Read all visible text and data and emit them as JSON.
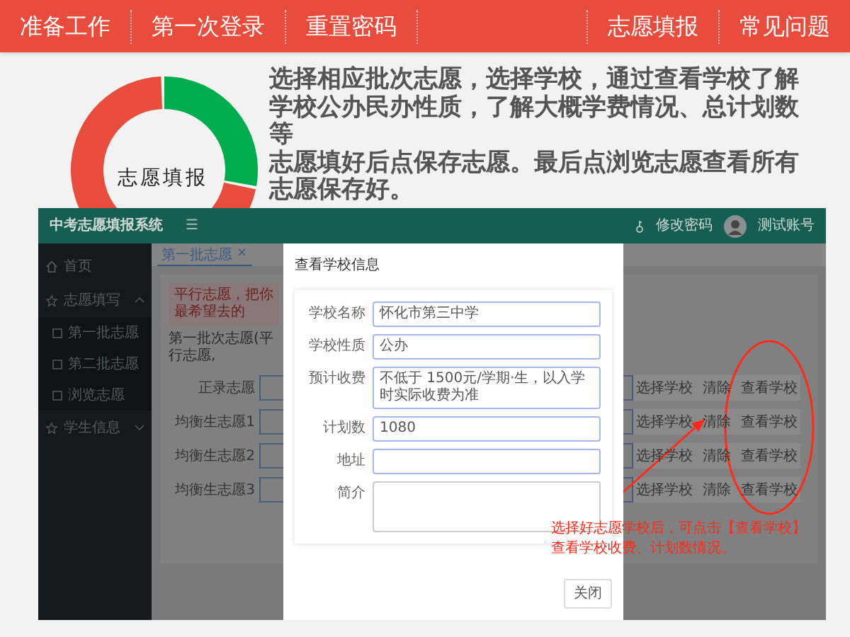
{
  "top_nav": {
    "left": [
      "准备工作",
      "第一次登录",
      "重置密码"
    ],
    "right": [
      "志愿填报",
      "常见问题"
    ]
  },
  "donut_label": "志愿填报",
  "intro": [
    "选择相应批次志愿，选择学校，通过查看学校了解学校公办民办性质，了解大概学费情况、总计划数等",
    "志愿填好后点保存志愿。最后点浏览志愿查看所有志愿保存好。"
  ],
  "app": {
    "title": "中考志愿填报系统",
    "menu_icon": "☰",
    "change_password": "修改密码",
    "account": "测试账号",
    "sidebar": [
      {
        "label": "首页"
      },
      {
        "label": "志愿填写",
        "expanded": true,
        "children": [
          {
            "label": "第一批志愿"
          },
          {
            "label": "第二批志愿"
          },
          {
            "label": "浏览志愿"
          }
        ]
      },
      {
        "label": "学生信息",
        "expanded": false
      }
    ],
    "tab": {
      "label": "第一批志愿",
      "close": "×"
    },
    "alert": "平行志愿，把你最希望去的",
    "card_title": "第一批次志愿(平行志愿,",
    "rows": [
      {
        "label": "正录志愿",
        "actions": [
          "选择学校",
          "清除",
          "查看学校"
        ]
      },
      {
        "label": "均衡生志愿1",
        "actions": [
          "选择学校",
          "清除",
          "查看学校"
        ]
      },
      {
        "label": "均衡生志愿2",
        "actions": [
          "选择学校",
          "清除",
          "查看学校"
        ]
      },
      {
        "label": "均衡生志愿3",
        "actions": [
          "选择学校",
          "清除",
          "查看学校"
        ]
      }
    ],
    "modal": {
      "title": "查看学校信息",
      "fields": [
        {
          "label": "学校名称",
          "value": "怀化市第三中学",
          "kind": "input"
        },
        {
          "label": "学校性质",
          "value": "公办",
          "kind": "input"
        },
        {
          "label": "预计收费",
          "value": "不低于 1500元/学期·生，以入学时实际收费为准",
          "kind": "input"
        },
        {
          "label": "计划数",
          "value": "1080",
          "kind": "input"
        },
        {
          "label": "地址",
          "kind": "input"
        },
        {
          "label": "简介",
          "kind": "textarea"
        }
      ],
      "close_button": "关闭"
    },
    "annotation": [
      "选择好志愿学校后，可点击【查看学校】",
      "查看学校收费、计划数情况。"
    ]
  }
}
